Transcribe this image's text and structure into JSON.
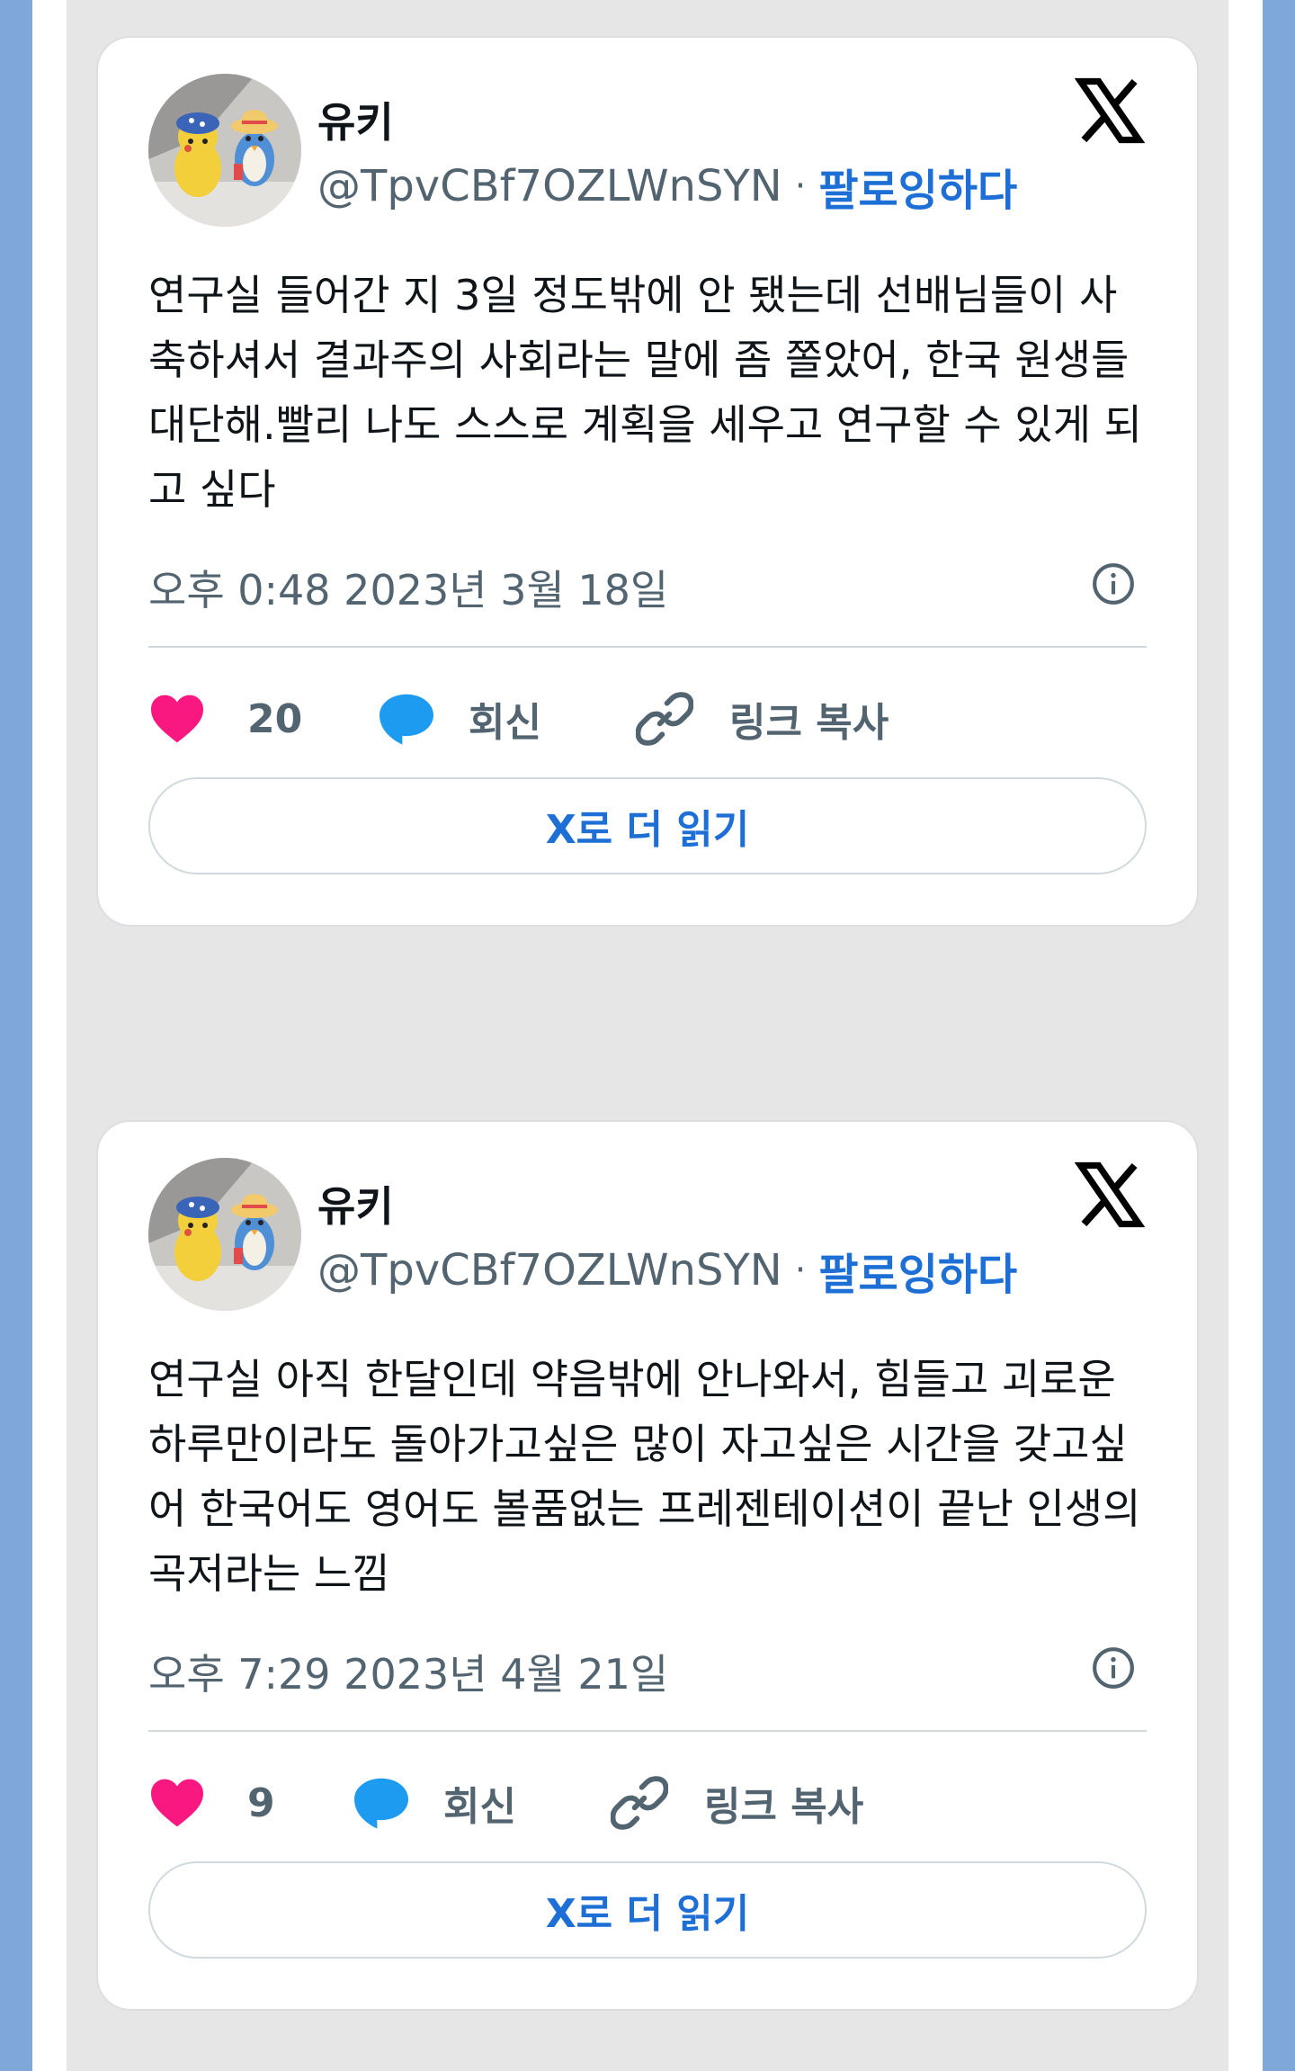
{
  "tweets": [
    {
      "author_name": "유키",
      "handle": "@TpvCBf7OZLWnSYN",
      "separator": "·",
      "follow_label": "팔로잉하다",
      "text": "연구실 들어간 지 3일 정도밖에 안 됐는데 선배님들이 사축하셔서 결과주의 사회라는 말에 좀 쫄았어, 한국 원생들 대단해.빨리 나도 스스로 계획을 세우고 연구할 수 있게 되고 싶다",
      "timestamp": "오후 0:48 2023년 3월 18일",
      "likes": "20",
      "reply_label": "회신",
      "copy_link_label": "링크 복사",
      "read_more_label": "X로 더 읽기"
    },
    {
      "author_name": "유키",
      "handle": "@TpvCBf7OZLWnSYN",
      "separator": "·",
      "follow_label": "팔로잉하다",
      "text": "연구실 아직 한달인데 약음밖에 안나와서, 힘들고 괴로운 하루만이라도 돌아가고싶은 많이 자고싶은 시간을 갖고싶어 한국어도 영어도 볼품없는 프레젠테이션이 끝난 인생의 곡저라는 느낌",
      "timestamp": "오후 7:29 2023년 4월 21일",
      "likes": "9",
      "reply_label": "회신",
      "copy_link_label": "링크 복사",
      "read_more_label": "X로 더 읽기"
    }
  ],
  "icons": {
    "like": "heart-icon",
    "reply": "speech-bubble-icon",
    "copy_link": "link-icon",
    "info": "info-icon",
    "brand": "x-logo-icon"
  },
  "colors": {
    "accent": "#1d6fd6",
    "like": "#f91880",
    "reply": "#1d9bf0",
    "muted_text": "#536471",
    "page_background": "#7fa8d9"
  }
}
